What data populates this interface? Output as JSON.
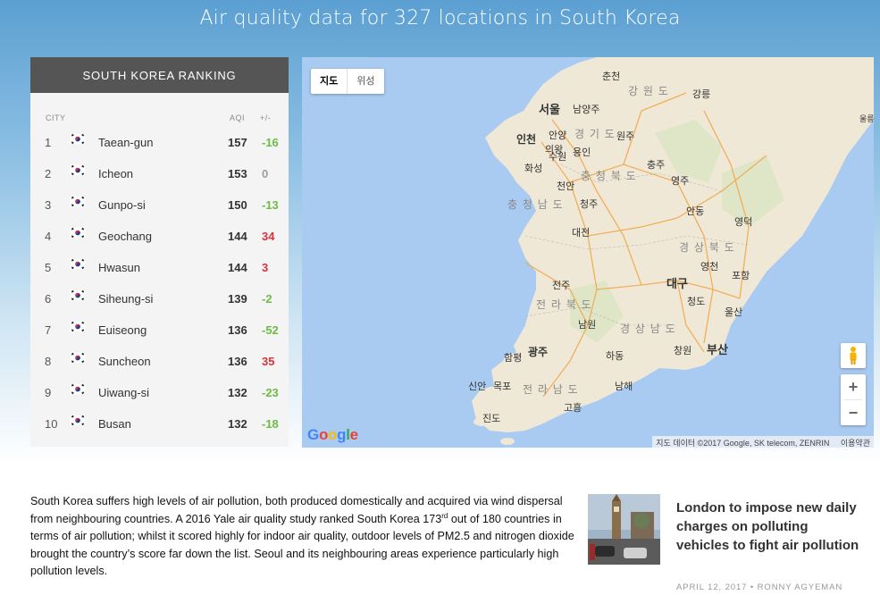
{
  "page": {
    "title": "Air quality data for 327 locations in South Korea"
  },
  "ranking": {
    "header": "SOUTH KOREA RANKING",
    "columns": {
      "city": "CITY",
      "aqi": "AQI",
      "change": "+/-"
    },
    "rows": [
      {
        "rank": "1",
        "city": "Taean-gun",
        "aqi": "157",
        "change": "-16",
        "trend": "down"
      },
      {
        "rank": "2",
        "city": "Icheon",
        "aqi": "153",
        "change": "0",
        "trend": "flat"
      },
      {
        "rank": "3",
        "city": "Gunpo-si",
        "aqi": "150",
        "change": "-13",
        "trend": "down"
      },
      {
        "rank": "4",
        "city": "Geochang",
        "aqi": "144",
        "change": "34",
        "trend": "up"
      },
      {
        "rank": "5",
        "city": "Hwasun",
        "aqi": "144",
        "change": "3",
        "trend": "up"
      },
      {
        "rank": "6",
        "city": "Siheung-si",
        "aqi": "139",
        "change": "-2",
        "trend": "down"
      },
      {
        "rank": "7",
        "city": "Euiseong",
        "aqi": "136",
        "change": "-52",
        "trend": "down"
      },
      {
        "rank": "8",
        "city": "Suncheon",
        "aqi": "136",
        "change": "35",
        "trend": "up"
      },
      {
        "rank": "9",
        "city": "Uiwang-si",
        "aqi": "132",
        "change": "-23",
        "trend": "down"
      },
      {
        "rank": "10",
        "city": "Busan",
        "aqi": "132",
        "change": "-18",
        "trend": "down"
      }
    ],
    "flag_icon": "south-korea-flag-icon",
    "colors": {
      "down": "#6dbb45",
      "up": "#d9343a",
      "flat": "#9e9e9e"
    }
  },
  "map": {
    "type_buttons": {
      "map": "지도",
      "satellite": "위성"
    },
    "zoom_in": "+",
    "zoom_out": "−",
    "logo": [
      "G",
      "o",
      "o",
      "g",
      "l",
      "e"
    ],
    "attribution": "지도 데이터 ©2017 Google, SK telecom, ZENRIN",
    "terms": "이용약관",
    "labels": {
      "chuncheon": "춘천",
      "gangwon": "강 원 도",
      "gangneung": "강릉",
      "seoul": "서울",
      "namyangju": "남양주",
      "incheon": "인천",
      "anyang": "안양",
      "gyeonggi": "경 기 도",
      "wonju": "원주",
      "uijeongbu": "의왕",
      "suwon": "수원",
      "yongin": "용인",
      "hwaseong": "화성",
      "chungbuk": "충 청 북 도",
      "chungju": "충주",
      "cheonan": "천안",
      "chungnam": "충 청 남 도",
      "cheongju": "청주",
      "yeongju": "영주",
      "andong": "안동",
      "yeongdeok": "영덕",
      "daejeon": "대전",
      "gyeongbuk": "경 상 북 도",
      "yeongcheon": "영천",
      "pohang": "포항",
      "daegu": "대구",
      "jeonju": "전주",
      "jeonbuk": "전 라 북 도",
      "cheongdo": "청도",
      "ulsan": "울산",
      "namwon": "남원",
      "gyeongnam": "경 상 남 도",
      "gwangju": "광주",
      "hampyeong": "함평",
      "changwon": "창원",
      "busan": "부산",
      "hadong": "하동",
      "sinan": "신안",
      "mokpo": "목포",
      "jeonnam": "전 라 남 도",
      "namhae": "남해",
      "goheung": "고흥",
      "jindo": "진도",
      "ulleung": "울릉"
    }
  },
  "article": {
    "text_before_sup": "South Korea suffers high levels of air pollution, both produced domestically and acquired via wind dispersal from neighbouring countries. A 2016 Yale air quality study ranked South Korea 173",
    "sup": "rd",
    "text_after_sup": " out of 180 countries in terms of air pollution; whilst it scored highly for indoor air quality, outdoor levels of PM2.5 and nitrogen dioxide brought the country’s score far down the list. Seoul and its neighbouring areas experience particularly high pollution levels."
  },
  "news": {
    "title": "London to impose new daily charges on polluting vehicles to fight air pollution",
    "date": "APRIL 12, 2017",
    "separator": "•",
    "author": "RONNY AGYEMAN"
  }
}
